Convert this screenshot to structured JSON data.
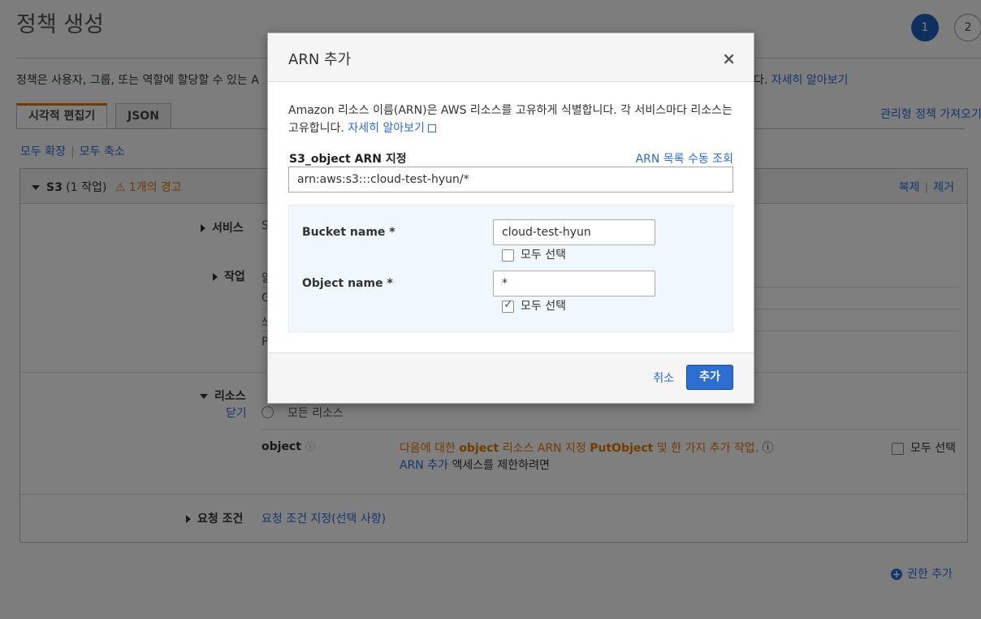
{
  "page": {
    "title": "정책 생성",
    "steps": [
      "1",
      "2"
    ],
    "description": "정책은 사용자, 그룹, 또는 역할에 할당할 수 있는 A",
    "description_tail": "다.",
    "learn_more": "자세히 알아보기",
    "tabs": [
      "시각적 편집기",
      "JSON"
    ],
    "import_managed": "관리형 정책 가져오기",
    "expand_all": "모두 확장",
    "collapse_all": "모두 축소",
    "service_block": {
      "service": "S3",
      "actions_count": "(1 작업)",
      "warning": "1개의 경고",
      "clone": "복제",
      "remove": "제거"
    },
    "rows": {
      "service_label": "서비스",
      "service_value": "S",
      "actions_label": "작업",
      "actions_lines": [
        "읽",
        "G",
        "쓰",
        "P"
      ],
      "resources_label": "리소스",
      "close_label": "닫기",
      "all_resources": "모든 리소스",
      "object_label": "object",
      "object_msg_1": "다음에 대한",
      "object_msg_bold1": "object",
      "object_msg_2": "리소스 ARN 지정",
      "object_msg_bold2": "PutObject",
      "object_msg_3": "및 한 가지 추가 작업.",
      "arn_add_link": "ARN 추가",
      "arn_add_tail": "액세스를 제한하려면",
      "select_all": "모두 선택",
      "conditions_label": "요청 조건",
      "conditions_link": "요청 조건 지정(선택 사항)"
    },
    "add_permission": "권한 추가"
  },
  "modal": {
    "title": "ARN 추가",
    "close": "×",
    "description": "Amazon 리소스 이름(ARN)은 AWS 리소스를 고유하게 식별합니다. 각 서비스마다 리소스는 고유합니다.",
    "learn_more": "자세히 알아보기",
    "field_label": "S3_object ARN 지정",
    "list_link": "ARN 목록 수동 조회",
    "arn_value": "arn:aws:s3:::cloud-test-hyun/*",
    "bucket_label": "Bucket name *",
    "bucket_value": "cloud-test-hyun",
    "bucket_select_all": "모두 선택",
    "bucket_checked": false,
    "object_label": "Object name *",
    "object_value": "*",
    "object_select_all": "모두 선택",
    "object_checked": true,
    "cancel": "취소",
    "add": "추가"
  },
  "colors": {
    "primary": "#2d6ed2",
    "link": "#2b6cd8",
    "warning": "#e57600",
    "overlay": "rgba(0,0,0,0.5)"
  }
}
